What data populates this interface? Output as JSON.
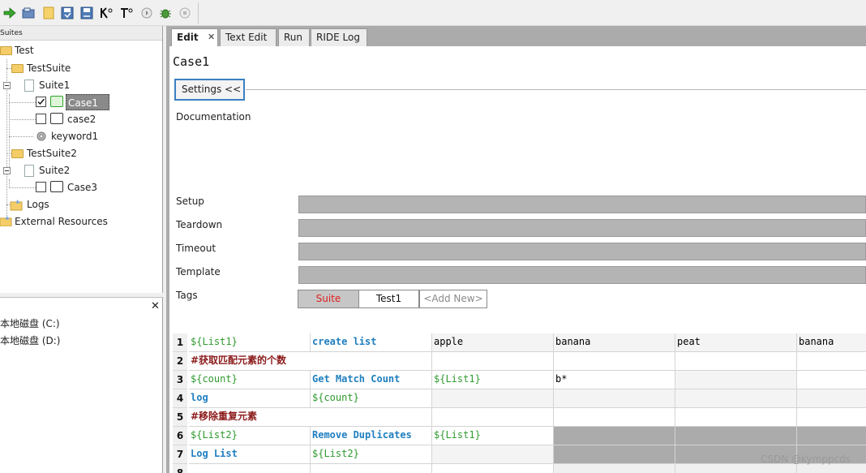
{
  "toolbar": {
    "icons": [
      "run-icon",
      "open-icon",
      "new-folder-icon",
      "save-icon",
      "save-all-icon",
      "search-keywords-icon",
      "search-tests-icon",
      "stop-icon",
      "debug-bug-icon",
      "pause-icon"
    ]
  },
  "tree": {
    "header": "Suites",
    "items": [
      {
        "label": "Test"
      },
      {
        "label": "TestSuite"
      },
      {
        "label": "Suite1"
      },
      {
        "label": "Case1"
      },
      {
        "label": "case2"
      },
      {
        "label": "keyword1"
      },
      {
        "label": "TestSuite2"
      },
      {
        "label": "Suite2"
      },
      {
        "label": "Case3"
      },
      {
        "label": "Logs"
      },
      {
        "label": "External Resources"
      }
    ]
  },
  "files": {
    "close": "✕",
    "drives": [
      "本地磁盘 (C:)",
      "本地磁盘 (D:)"
    ]
  },
  "tabs": [
    {
      "label": "Edit",
      "close": "✕",
      "active": true
    },
    {
      "label": "Text Edit"
    },
    {
      "label": "Run"
    },
    {
      "label": "RIDE Log"
    }
  ],
  "editor": {
    "title": "Case1",
    "settings_button": "Settings <<",
    "labels": {
      "documentation": "Documentation",
      "setup": "Setup",
      "teardown": "Teardown",
      "timeout": "Timeout",
      "template": "Template",
      "tags": "Tags"
    },
    "tags": [
      {
        "label": "Suite"
      },
      {
        "label": "Test1"
      },
      {
        "label": "<Add New>"
      }
    ]
  },
  "grid": {
    "rows": [
      {
        "num": "1",
        "cells": [
          "${List1}",
          "create list",
          "apple",
          "banana",
          "peat",
          "banana"
        ]
      },
      {
        "num": "2",
        "cells": [
          "#获取匹配元素的个数",
          "",
          "",
          "",
          "",
          ""
        ]
      },
      {
        "num": "3",
        "cells": [
          "${count}",
          "Get Match Count",
          "${List1}",
          "b*",
          "",
          ""
        ]
      },
      {
        "num": "4",
        "cells": [
          "log",
          "${count}",
          "",
          "",
          "",
          ""
        ]
      },
      {
        "num": "5",
        "cells": [
          "#移除重复元素",
          "",
          "",
          "",
          "",
          ""
        ]
      },
      {
        "num": "6",
        "cells": [
          "${List2}",
          "Remove Duplicates",
          "${List1}",
          "",
          "",
          ""
        ]
      },
      {
        "num": "7",
        "cells": [
          "Log List",
          "${List2}",
          "",
          "",
          "",
          ""
        ]
      },
      {
        "num": "8",
        "cells": [
          "",
          "",
          "",
          "",
          "",
          ""
        ]
      }
    ]
  },
  "colors": {
    "variable": "#2e9a2e",
    "keyword": "#1f7fbf",
    "comment": "#8b1a1a",
    "tag_highlight": "#e02020",
    "accent_border": "#3a7fc1"
  },
  "watermark": "CSDN @kymppcds"
}
